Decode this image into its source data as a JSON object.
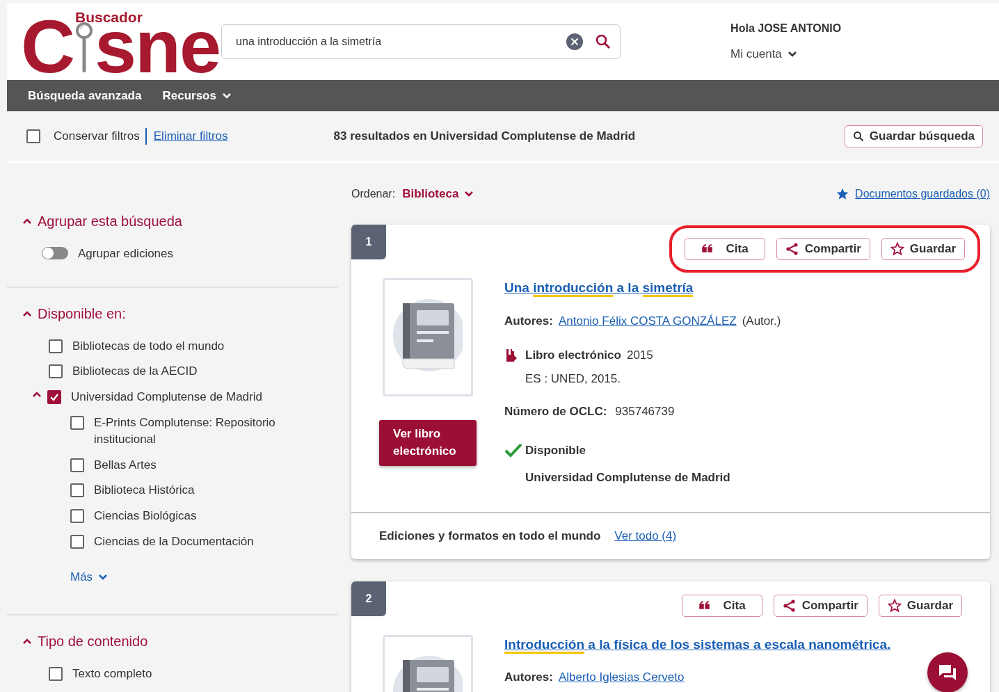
{
  "logo": {
    "small": "Buscador",
    "left": "C",
    "right": "sne"
  },
  "search": {
    "value": "una introducción a la simetría"
  },
  "user": {
    "greeting": "Hola JOSE ANTONIO",
    "account": "Mi cuenta"
  },
  "nav": [
    {
      "label": "Búsqueda avanzada",
      "dropdown": false
    },
    {
      "label": "Recursos",
      "dropdown": true
    }
  ],
  "filter_bar": {
    "keep_filters": {
      "label": "Conservar filtros",
      "checked": false
    },
    "clear_link": "Eliminar filtros",
    "results_summary": "83 resultados en Universidad Complutense de Madrid",
    "save_search": "Guardar búsqueda"
  },
  "sort": {
    "label": "Ordenar:",
    "value": "Biblioteca"
  },
  "saved_docs": "Documentos guardados (0)",
  "sidebar": [
    {
      "title": "Agrupar esta búsqueda",
      "expanded": true,
      "items": [
        {
          "kind": "toggle",
          "label": "Agrupar ediciones",
          "on": false
        }
      ]
    },
    {
      "title": "Disponible en:",
      "expanded": true,
      "more": "Más",
      "items": [
        {
          "kind": "checkbox",
          "label": "Bibliotecas de todo el mundo",
          "checked": false
        },
        {
          "kind": "checkbox",
          "label": "Bibliotecas de la AECID",
          "checked": false
        },
        {
          "kind": "checkbox",
          "label": "Universidad Complutense de Madrid",
          "checked": true,
          "expanded": true,
          "children": [
            {
              "kind": "checkbox",
              "label": "E-Prints Complutense: Repositorio institucional",
              "checked": false
            },
            {
              "kind": "checkbox",
              "label": "Bellas Artes",
              "checked": false
            },
            {
              "kind": "checkbox",
              "label": "Biblioteca Histórica",
              "checked": false
            },
            {
              "kind": "checkbox",
              "label": "Ciencias Biológicas",
              "checked": false
            },
            {
              "kind": "checkbox",
              "label": "Ciencias de la Documentación",
              "checked": false
            }
          ]
        }
      ]
    },
    {
      "title": "Tipo de contenido",
      "expanded": true,
      "items": [
        {
          "kind": "checkbox",
          "label": "Texto completo",
          "checked": false
        }
      ]
    }
  ],
  "results": [
    {
      "number": "1",
      "circled": true,
      "actions": [
        {
          "kind": "cite",
          "label": "Cita"
        },
        {
          "kind": "share",
          "label": "Compartir"
        },
        {
          "kind": "save",
          "label": "Guardar"
        }
      ],
      "title": [
        {
          "text": "Una ",
          "highlight": false
        },
        {
          "text": "introducción",
          "highlight": true
        },
        {
          "text": " a la ",
          "highlight": false
        },
        {
          "text": "simetría",
          "highlight": true
        }
      ],
      "authors_label": "Autores:",
      "author": "Antonio Félix COSTA GONZÁLEZ",
      "author_role": "(Autor.)",
      "format": "Libro electrónico",
      "year": "2015",
      "publisher": "ES : UNED, 2015.",
      "oclc_label": "Número de OCLC:",
      "oclc": "935746739",
      "availability": "Disponible",
      "library": "Universidad Complutense de Madrid",
      "access_button": "Ver libro electrónico",
      "editions_label": "Ediciones y formatos en todo el mundo",
      "editions_link": "Ver todo (4)"
    },
    {
      "number": "2",
      "circled": false,
      "actions": [
        {
          "kind": "cite",
          "label": "Cita"
        },
        {
          "kind": "share",
          "label": "Compartir"
        },
        {
          "kind": "save",
          "label": "Guardar"
        }
      ],
      "title": [
        {
          "text": "Introducción",
          "highlight": true
        },
        {
          "text": " a la física de los sistemas a escala nanométrica.",
          "highlight": false
        }
      ],
      "authors_label": "Autores:",
      "author": "Alberto Iglesias Cerveto"
    }
  ]
}
